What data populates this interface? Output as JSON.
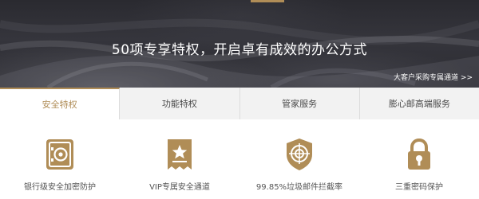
{
  "banner": {
    "title": "50项专享特权，开启卓有成效的办公方式",
    "link": "大客户采购专属通道 >>"
  },
  "tabs": [
    {
      "label": "安全特权",
      "active": true
    },
    {
      "label": "功能特权",
      "active": false
    },
    {
      "label": "管家服务",
      "active": false
    },
    {
      "label": "膨心邮高端服务",
      "active": false
    }
  ],
  "features": [
    {
      "label": "银行级安全加密防护",
      "icon": "safe-icon"
    },
    {
      "label": "VIP专属安全通道",
      "icon": "vip-channel-icon"
    },
    {
      "label": "99.85%垃圾邮件拦截率",
      "icon": "target-shield-icon"
    },
    {
      "label": "三重密码保护",
      "icon": "padlock-icon"
    }
  ],
  "colors": {
    "accent": "#b08d57",
    "banner_bg": "#2f2f35",
    "tab_bg": "#f2f2f2",
    "text": "#555555"
  }
}
